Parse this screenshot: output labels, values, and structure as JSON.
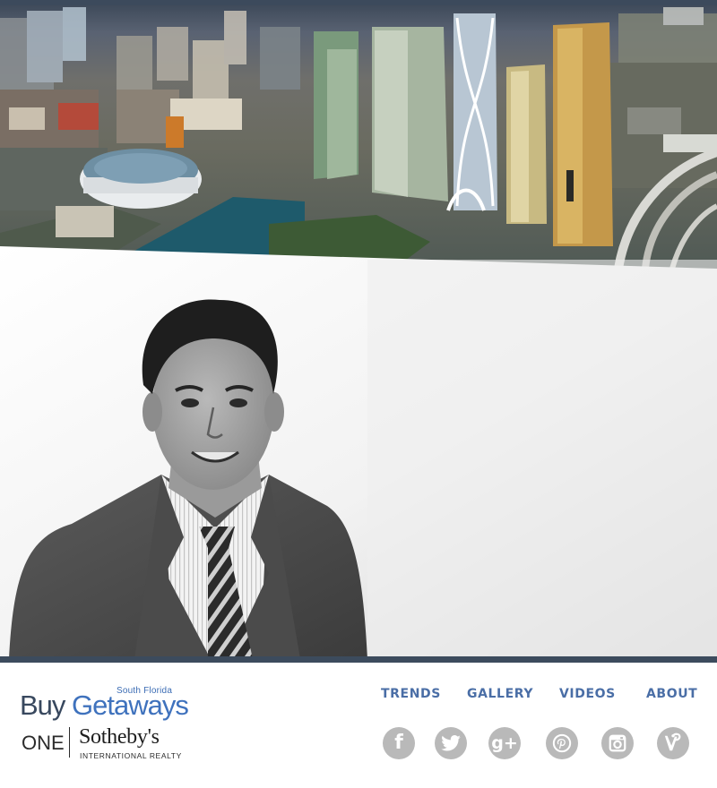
{
  "hero": {
    "image_alt": "Aerial view of Miami downtown skyline with arena and bay"
  },
  "portrait": {
    "image_alt": "Black and white portrait of a smiling man in suit and striped tie"
  },
  "footer": {
    "brand": {
      "sub_label": "South Florida",
      "buy_text": "Buy",
      "getaways_text": "Getaways"
    },
    "partner": {
      "one_text": "ONE",
      "name_text": "Sotheby's",
      "tagline": "INTERNATIONAL REALTY"
    },
    "nav": [
      {
        "label": "TRENDS"
      },
      {
        "label": "GALLERY"
      },
      {
        "label": "VIDEOS"
      },
      {
        "label": "ABOUT"
      }
    ],
    "social": [
      {
        "icon": "facebook-icon",
        "glyph": "f"
      },
      {
        "icon": "twitter-icon",
        "glyph": "t"
      },
      {
        "icon": "google-plus-icon",
        "glyph": "g+"
      },
      {
        "icon": "pinterest-icon",
        "glyph": "p"
      },
      {
        "icon": "instagram-icon",
        "glyph": "◘"
      },
      {
        "icon": "vine-icon",
        "glyph": "v"
      }
    ]
  },
  "colors": {
    "nav_link": "#4a6ea6",
    "divider": "#3c4b5d",
    "social_circle": "#b9b9b9",
    "brand_blue": "#3f72bd",
    "brand_dark": "#38485e"
  }
}
